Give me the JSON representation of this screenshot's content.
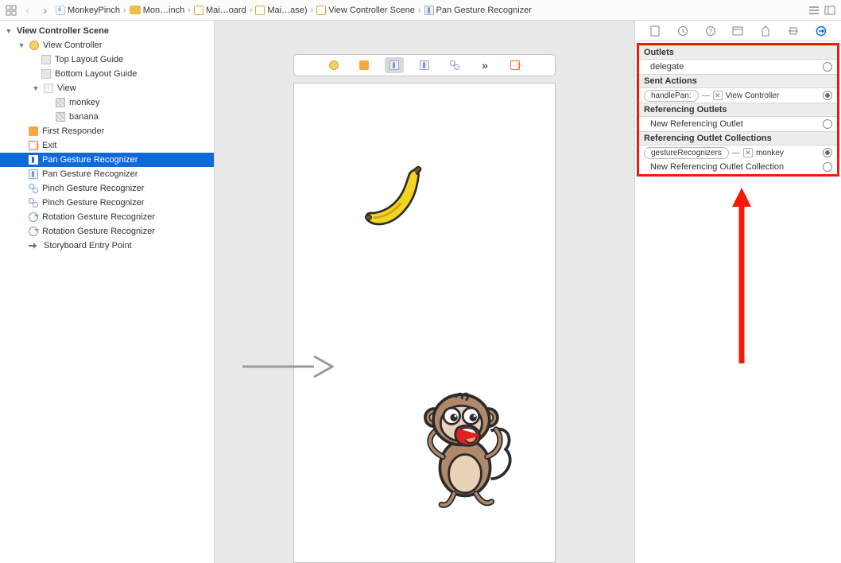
{
  "breadcrumbs": {
    "b0": "MonkeyPinch",
    "b1": "Mon…inch",
    "b2": "Mai…oard",
    "b3": "Mai…ase)",
    "b4": "View Controller Scene",
    "b5": "Pan Gesture Recognizer"
  },
  "outline": {
    "scene": "View Controller Scene",
    "vc": "View Controller",
    "tlg": "Top Layout Guide",
    "blg": "Bottom Layout Guide",
    "view": "View",
    "monkey": "monkey",
    "banana": "banana",
    "fr": "First Responder",
    "exit": "Exit",
    "pan1": "Pan Gesture Recognizer",
    "pan2": "Pan Gesture Recognizer",
    "pinch1": "Pinch Gesture Recognizer",
    "pinch2": "Pinch Gesture Recognizer",
    "rot1": "Rotation Gesture Recognizer",
    "rot2": "Rotation Gesture Recognizer",
    "entry": "Storyboard Entry Point"
  },
  "inspector": {
    "outlets_head": "Outlets",
    "delegate": "delegate",
    "sent_head": "Sent Actions",
    "handlePan": "handlePan:",
    "vc_target": "View Controller",
    "ref_head": "Referencing Outlets",
    "new_ref": "New Referencing Outlet",
    "refcol_head": "Referencing Outlet Collections",
    "gr": "gestureRecognizers",
    "monkey_target": "monkey",
    "new_refcol": "New Referencing Outlet Collection"
  }
}
